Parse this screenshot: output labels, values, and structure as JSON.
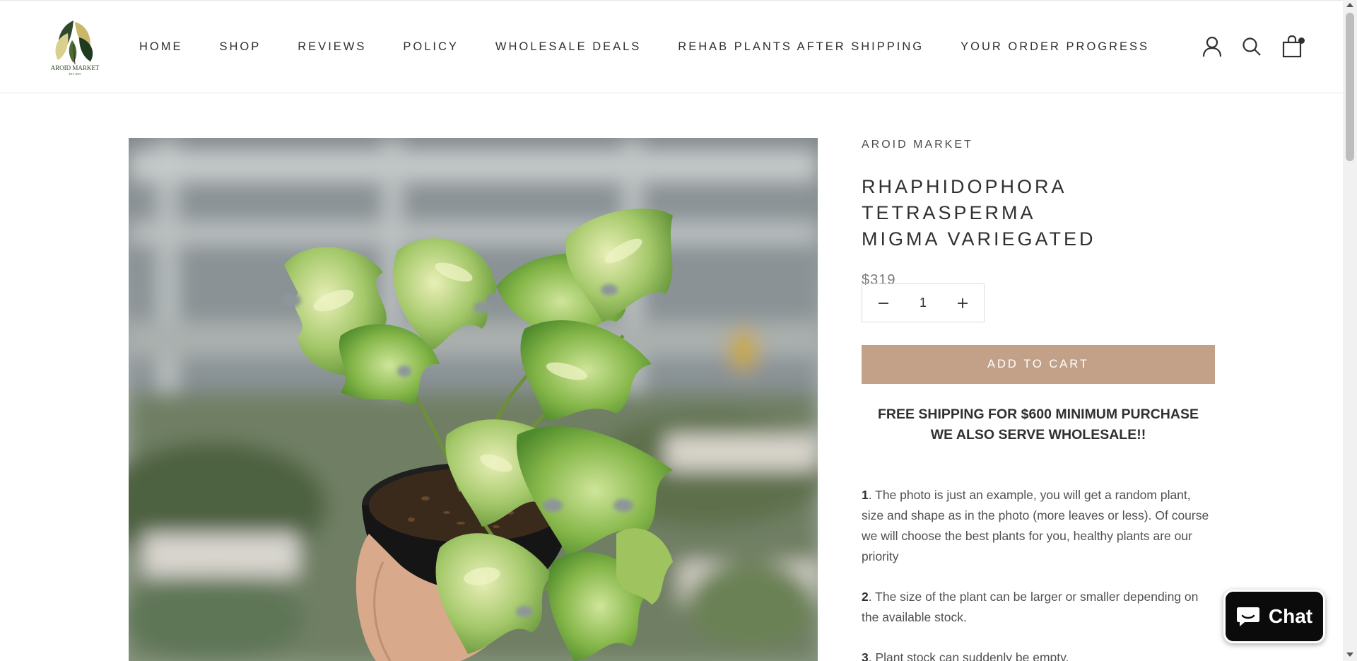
{
  "store": {
    "logo_text": "AROID MARKET",
    "logo_subtext": "EST. 2019"
  },
  "nav": {
    "items": [
      {
        "label": "HOME"
      },
      {
        "label": "SHOP"
      },
      {
        "label": "REVIEWS"
      },
      {
        "label": "POLICY"
      },
      {
        "label": "WHOLESALE DEALS"
      },
      {
        "label": "REHAB PLANTS AFTER SHIPPING"
      },
      {
        "label": "YOUR ORDER PROGRESS"
      }
    ]
  },
  "header_icons": [
    "account-icon",
    "search-icon",
    "cart-icon"
  ],
  "product": {
    "vendor": "AROID MARKET",
    "title_line1": "RHAPHIDOPHORA TETRASPERMA",
    "title_line2": "MIGMA VARIEGATED",
    "price": "$319",
    "quantity": "1",
    "add_to_cart_label": "ADD TO CART",
    "promo_line1": "FREE SHIPPING FOR $600 MINIMUM PURCHASE",
    "promo_line2": "WE ALSO SERVE WHOLESALE!!",
    "description": [
      {
        "num": "1",
        "text": ". The photo is just an example, you will get a random plant, size and shape as in the photo (more leaves or less). Of course we will choose the best plants for you, healthy plants are our priority"
      },
      {
        "num": "2",
        "text": ". The size of the plant can be larger or smaller depending on the available stock."
      },
      {
        "num": "3",
        "text": ". Plant stock can suddenly be empty."
      }
    ]
  },
  "chat": {
    "label": "Chat"
  },
  "colors": {
    "add_to_cart_bg": "#c2a188",
    "text": "#303030",
    "chat_bg": "#0b0b0b"
  }
}
